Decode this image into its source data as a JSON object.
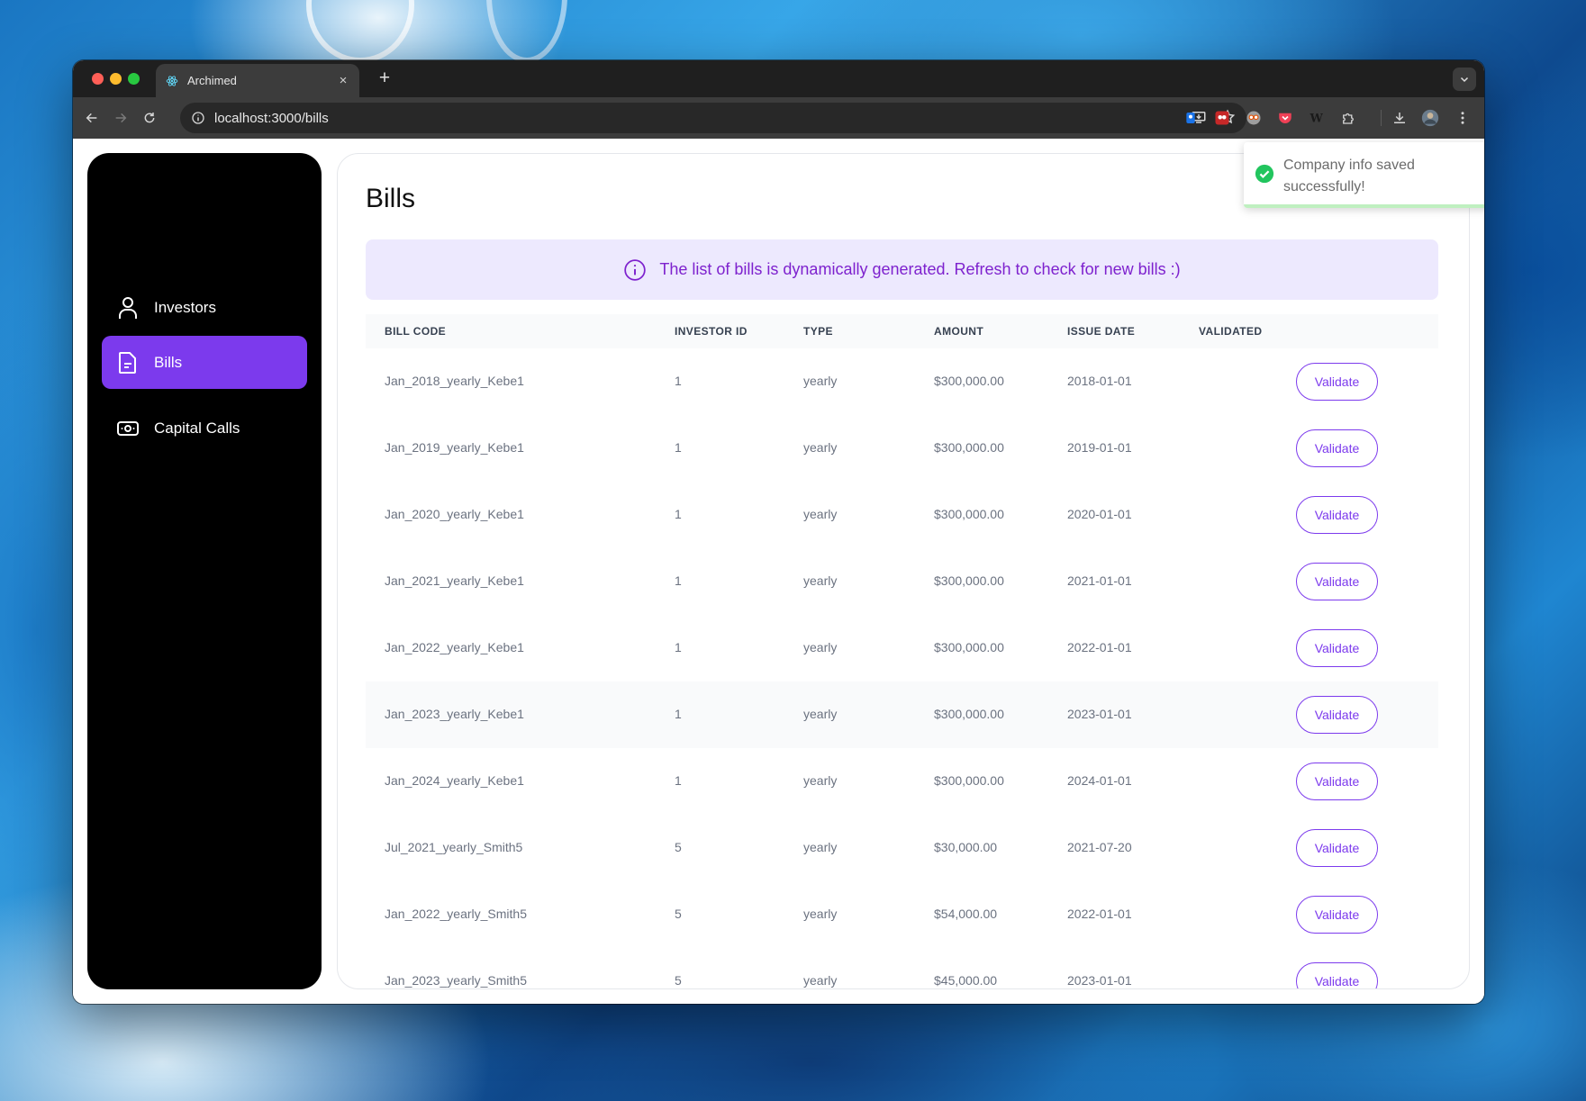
{
  "browser": {
    "tab_title": "Archimed",
    "url": "localhost:3000/bills",
    "new_tab_label": "+",
    "tab_close_label": "×"
  },
  "sidebar": {
    "items": [
      {
        "label": "Investors",
        "icon": "user-icon",
        "active": false
      },
      {
        "label": "Bills",
        "icon": "document-icon",
        "active": true
      },
      {
        "label": "Capital Calls",
        "icon": "banknote-icon",
        "active": false
      }
    ]
  },
  "page": {
    "title": "Bills",
    "info_message": "The list of bills is dynamically generated. Refresh to check for new bills :)"
  },
  "table": {
    "headers": [
      "BILL CODE",
      "INVESTOR ID",
      "TYPE",
      "AMOUNT",
      "ISSUE DATE",
      "VALIDATED"
    ],
    "rows": [
      {
        "bill_code": "Jan_2018_yearly_Kebe1",
        "investor_id": "1",
        "type": "yearly",
        "amount": "$300,000.00",
        "issue_date": "2018-01-01",
        "action": "Validate"
      },
      {
        "bill_code": "Jan_2019_yearly_Kebe1",
        "investor_id": "1",
        "type": "yearly",
        "amount": "$300,000.00",
        "issue_date": "2019-01-01",
        "action": "Validate"
      },
      {
        "bill_code": "Jan_2020_yearly_Kebe1",
        "investor_id": "1",
        "type": "yearly",
        "amount": "$300,000.00",
        "issue_date": "2020-01-01",
        "action": "Validate"
      },
      {
        "bill_code": "Jan_2021_yearly_Kebe1",
        "investor_id": "1",
        "type": "yearly",
        "amount": "$300,000.00",
        "issue_date": "2021-01-01",
        "action": "Validate"
      },
      {
        "bill_code": "Jan_2022_yearly_Kebe1",
        "investor_id": "1",
        "type": "yearly",
        "amount": "$300,000.00",
        "issue_date": "2022-01-01",
        "action": "Validate"
      },
      {
        "bill_code": "Jan_2023_yearly_Kebe1",
        "investor_id": "1",
        "type": "yearly",
        "amount": "$300,000.00",
        "issue_date": "2023-01-01",
        "action": "Validate"
      },
      {
        "bill_code": "Jan_2024_yearly_Kebe1",
        "investor_id": "1",
        "type": "yearly",
        "amount": "$300,000.00",
        "issue_date": "2024-01-01",
        "action": "Validate"
      },
      {
        "bill_code": "Jul_2021_yearly_Smith5",
        "investor_id": "5",
        "type": "yearly",
        "amount": "$30,000.00",
        "issue_date": "2021-07-20",
        "action": "Validate"
      },
      {
        "bill_code": "Jan_2022_yearly_Smith5",
        "investor_id": "5",
        "type": "yearly",
        "amount": "$54,000.00",
        "issue_date": "2022-01-01",
        "action": "Validate"
      },
      {
        "bill_code": "Jan_2023_yearly_Smith5",
        "investor_id": "5",
        "type": "yearly",
        "amount": "$45,000.00",
        "issue_date": "2023-01-01",
        "action": "Validate"
      }
    ]
  },
  "toast": {
    "message": "Company info saved successfully!",
    "close_label": "×",
    "status": "success",
    "progress_fraction": 0.98
  },
  "colors": {
    "accent": "#7c3aed",
    "banner_bg": "#ede9fe",
    "banner_text": "#7e22ce",
    "success": "#22c55e"
  }
}
